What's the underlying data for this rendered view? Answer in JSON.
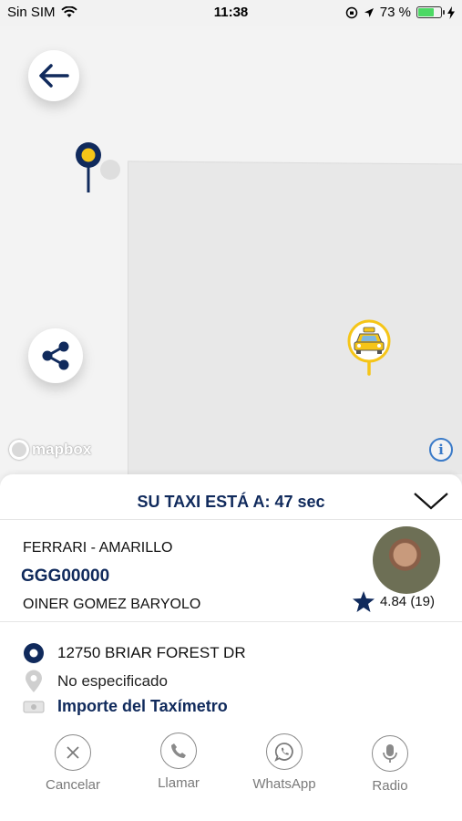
{
  "status_bar": {
    "carrier": "Sin SIM",
    "time": "11:38",
    "battery_pct": "73 %",
    "battery_level": 0.73
  },
  "map": {
    "attribution": "mapbox",
    "info_glyph": "i"
  },
  "sheet": {
    "eta": "SU TAXI ESTÁ A: 47 sec",
    "driver": {
      "car_model": "FERRARI - AMARILLO",
      "plate": "GGG00000",
      "name": "OINER GOMEZ BARYOLO",
      "rating": "4.84 (19)"
    },
    "trip": {
      "origin": "12750 BRIAR FOREST DR",
      "destination": "No especificado",
      "fare": "Importe del Taxímetro"
    },
    "actions": [
      {
        "label": "Cancelar",
        "icon": "close-icon"
      },
      {
        "label": "Llamar",
        "icon": "phone-icon"
      },
      {
        "label": "WhatsApp",
        "icon": "whatsapp-icon"
      },
      {
        "label": "Radio",
        "icon": "microphone-icon"
      }
    ]
  },
  "colors": {
    "navy": "#102a5c",
    "taxi_yellow": "#f5c518",
    "battery_green": "#4cd964"
  }
}
